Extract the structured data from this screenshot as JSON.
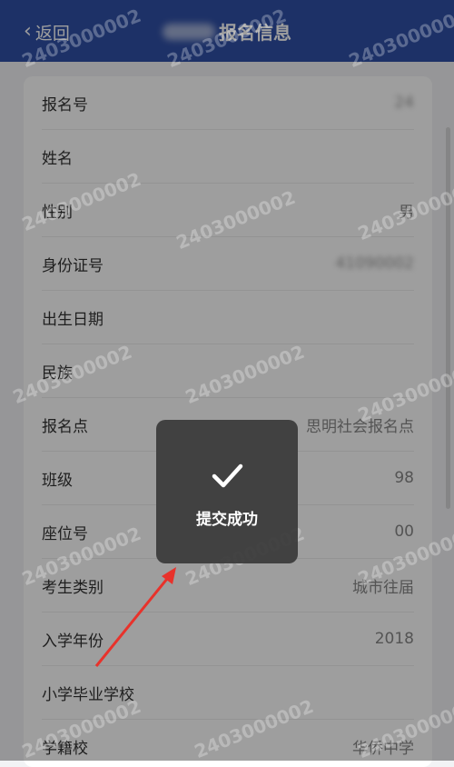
{
  "header": {
    "back_label": "返回",
    "title": "报名信息"
  },
  "rows": [
    {
      "label": "报名号",
      "value": "24",
      "blurred": true
    },
    {
      "label": "姓名",
      "value": "",
      "blurred": true
    },
    {
      "label": "性别",
      "value": "男",
      "blurred": false
    },
    {
      "label": "身份证号",
      "value": "41090002",
      "blurred": true
    },
    {
      "label": "出生日期",
      "value": "",
      "blurred": false
    },
    {
      "label": "民族",
      "value": "",
      "blurred": false
    },
    {
      "label": "报名点",
      "value": "思明社会报名点",
      "blurred": false
    },
    {
      "label": "班级",
      "value": "98",
      "blurred": false
    },
    {
      "label": "座位号",
      "value": "00",
      "blurred": false
    },
    {
      "label": "考生类别",
      "value": "城市往届",
      "blurred": false
    },
    {
      "label": "入学年份",
      "value": "2018",
      "blurred": false
    },
    {
      "label": "小学毕业学校",
      "value": "",
      "blurred": false
    },
    {
      "label": "学籍校",
      "value": "华侨中学",
      "blurred": false
    }
  ],
  "toast": {
    "icon": "checkmark-icon",
    "message": "提交成功"
  },
  "watermark": "2403000002",
  "colors": {
    "header_bg": "#2f4fa6",
    "arrow": "#e8322b"
  }
}
